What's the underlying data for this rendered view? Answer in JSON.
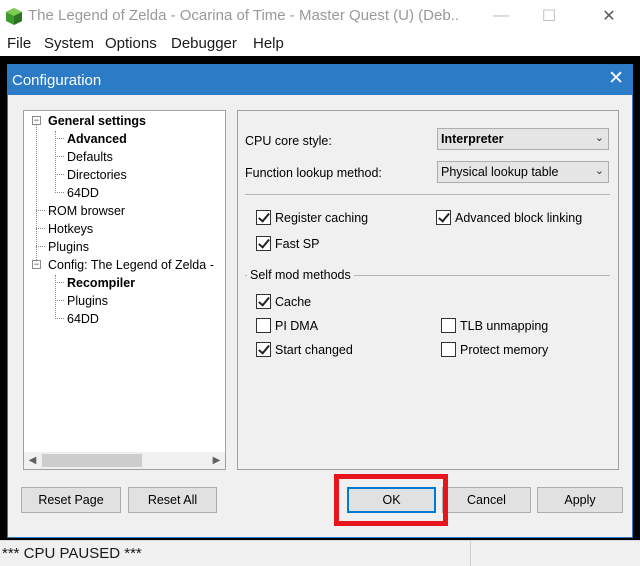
{
  "window": {
    "title": "The Legend of Zelda - Ocarina of Time - Master Quest (U) (Deb...",
    "icon": "project64-icon",
    "controls": {
      "minimize": "—",
      "maximize": "☐",
      "close": "✕"
    }
  },
  "menubar": [
    "File",
    "System",
    "Options",
    "Debugger",
    "Help"
  ],
  "dialog": {
    "title": "Configuration",
    "close": "✕",
    "tree": {
      "general": "General settings",
      "general_children": [
        "Advanced",
        "Defaults",
        "Directories",
        "64DD"
      ],
      "top_items": [
        "ROM browser",
        "Hotkeys",
        "Plugins"
      ],
      "config": "Config: The Legend of Zelda -",
      "config_children": [
        "Recompiler",
        "Plugins",
        "64DD"
      ],
      "toggle_expanded": "−"
    },
    "panel": {
      "cpu_core_label": "CPU core style:",
      "cpu_core_value": "Interpreter",
      "lookup_label": "Function lookup method:",
      "lookup_value": "Physical lookup table",
      "options": {
        "register_caching": {
          "label": "Register caching",
          "checked": true
        },
        "advanced_block_linking": {
          "label": "Advanced block linking",
          "checked": true
        },
        "fast_sp": {
          "label": "Fast SP",
          "checked": true
        }
      },
      "self_mod_title": "Self mod methods",
      "self_mod": {
        "cache": {
          "label": "Cache",
          "checked": true
        },
        "pi_dma": {
          "label": "PI DMA",
          "checked": false
        },
        "tlb_unmapping": {
          "label": "TLB unmapping",
          "checked": false
        },
        "start_changed": {
          "label": "Start changed",
          "checked": true
        },
        "protect_memory": {
          "label": "Protect memory",
          "checked": false
        }
      }
    },
    "buttons": {
      "reset_page": "Reset Page",
      "reset_all": "Reset All",
      "ok": "OK",
      "cancel": "Cancel",
      "apply": "Apply"
    },
    "highlight_color": "#e8141b",
    "accent": "#2c7bc6"
  },
  "status": "*** CPU PAUSED ***"
}
